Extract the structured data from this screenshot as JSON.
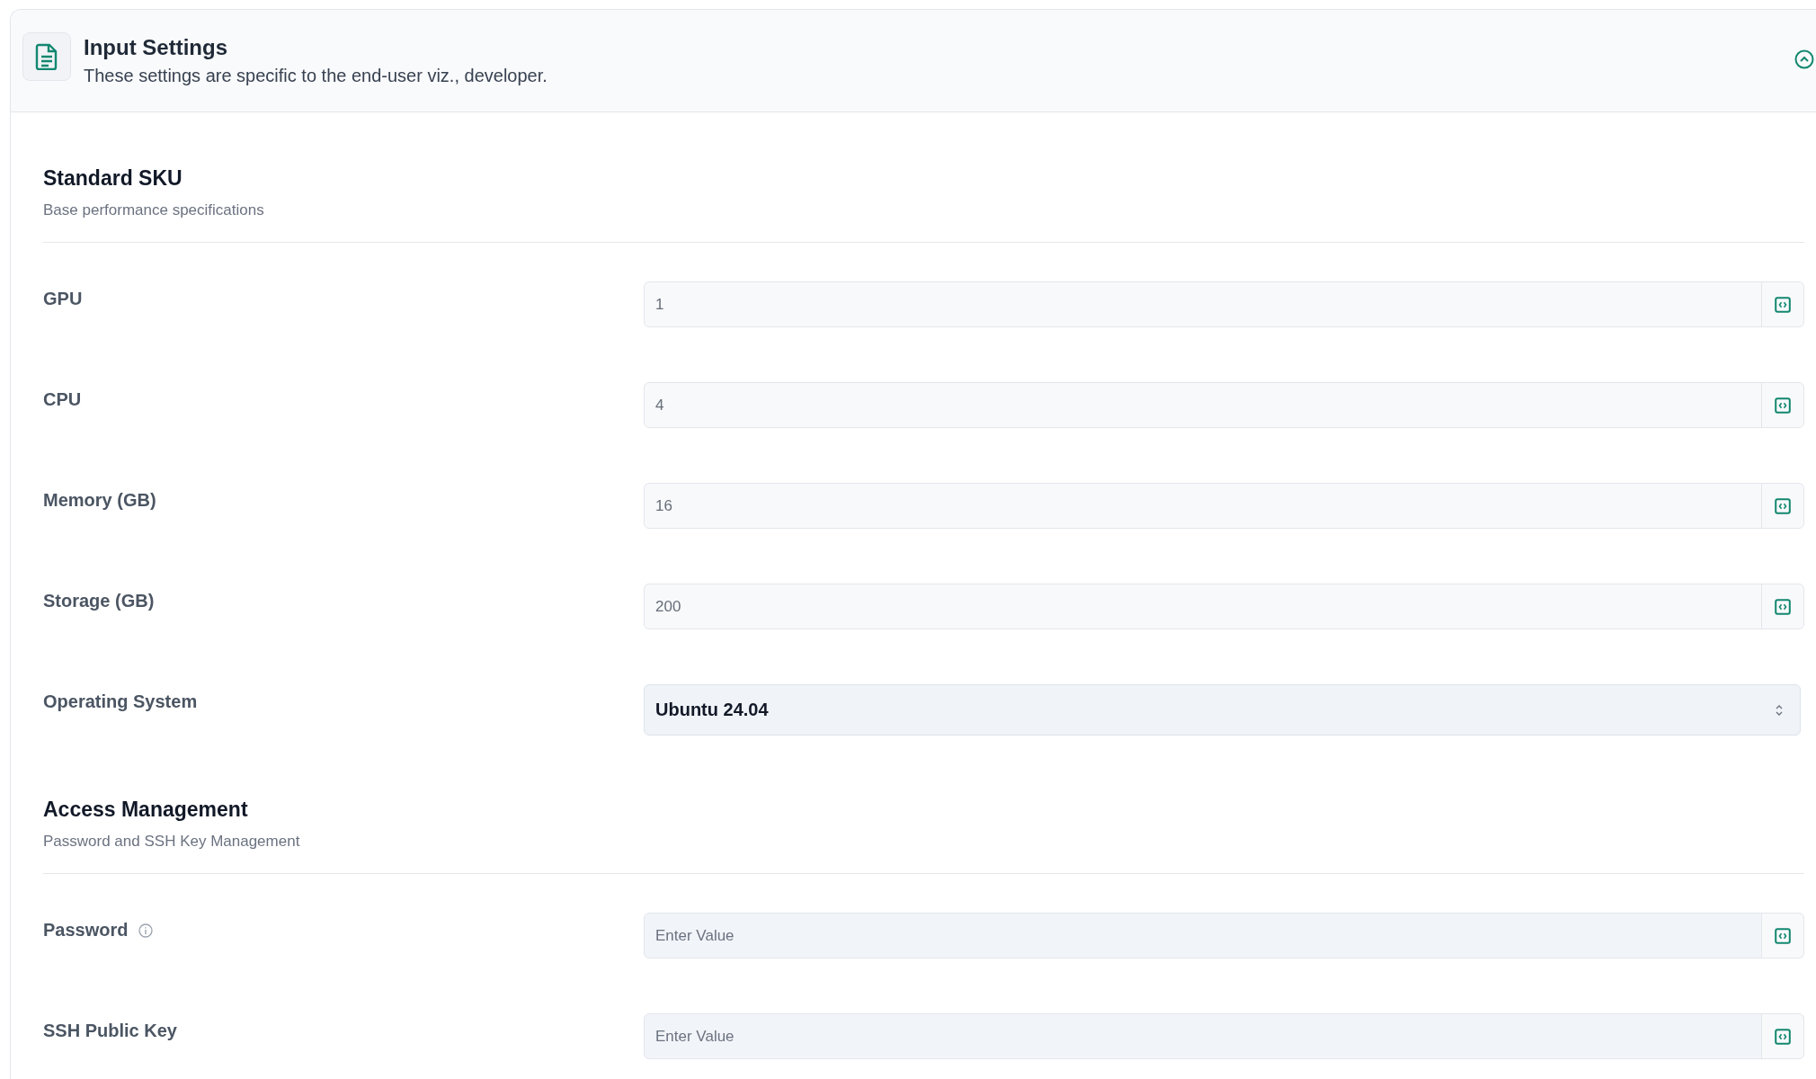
{
  "panel": {
    "title": "Input Settings",
    "subtitle": "These settings are specific to the end-user viz., developer.",
    "expanded": true
  },
  "sections": [
    {
      "title": "Standard SKU",
      "description": "Base performance specifications",
      "fields": [
        {
          "kind": "text",
          "label": "GPU",
          "value": "1",
          "disabled": true
        },
        {
          "kind": "text",
          "label": "CPU",
          "value": "4",
          "disabled": true
        },
        {
          "kind": "text",
          "label": "Memory (GB)",
          "value": "16",
          "disabled": true
        },
        {
          "kind": "text",
          "label": "Storage (GB)",
          "value": "200",
          "disabled": true
        },
        {
          "kind": "select",
          "label": "Operating System",
          "value": "Ubuntu 24.04"
        }
      ]
    },
    {
      "title": "Access Management",
      "description": "Password and SSH Key Management",
      "fields": [
        {
          "kind": "text",
          "label": "Password",
          "placeholder": "Enter Value",
          "disabled": false,
          "info": true
        },
        {
          "kind": "text",
          "label": "SSH Public Key",
          "placeholder": "Enter Value",
          "disabled": false
        }
      ]
    }
  ]
}
